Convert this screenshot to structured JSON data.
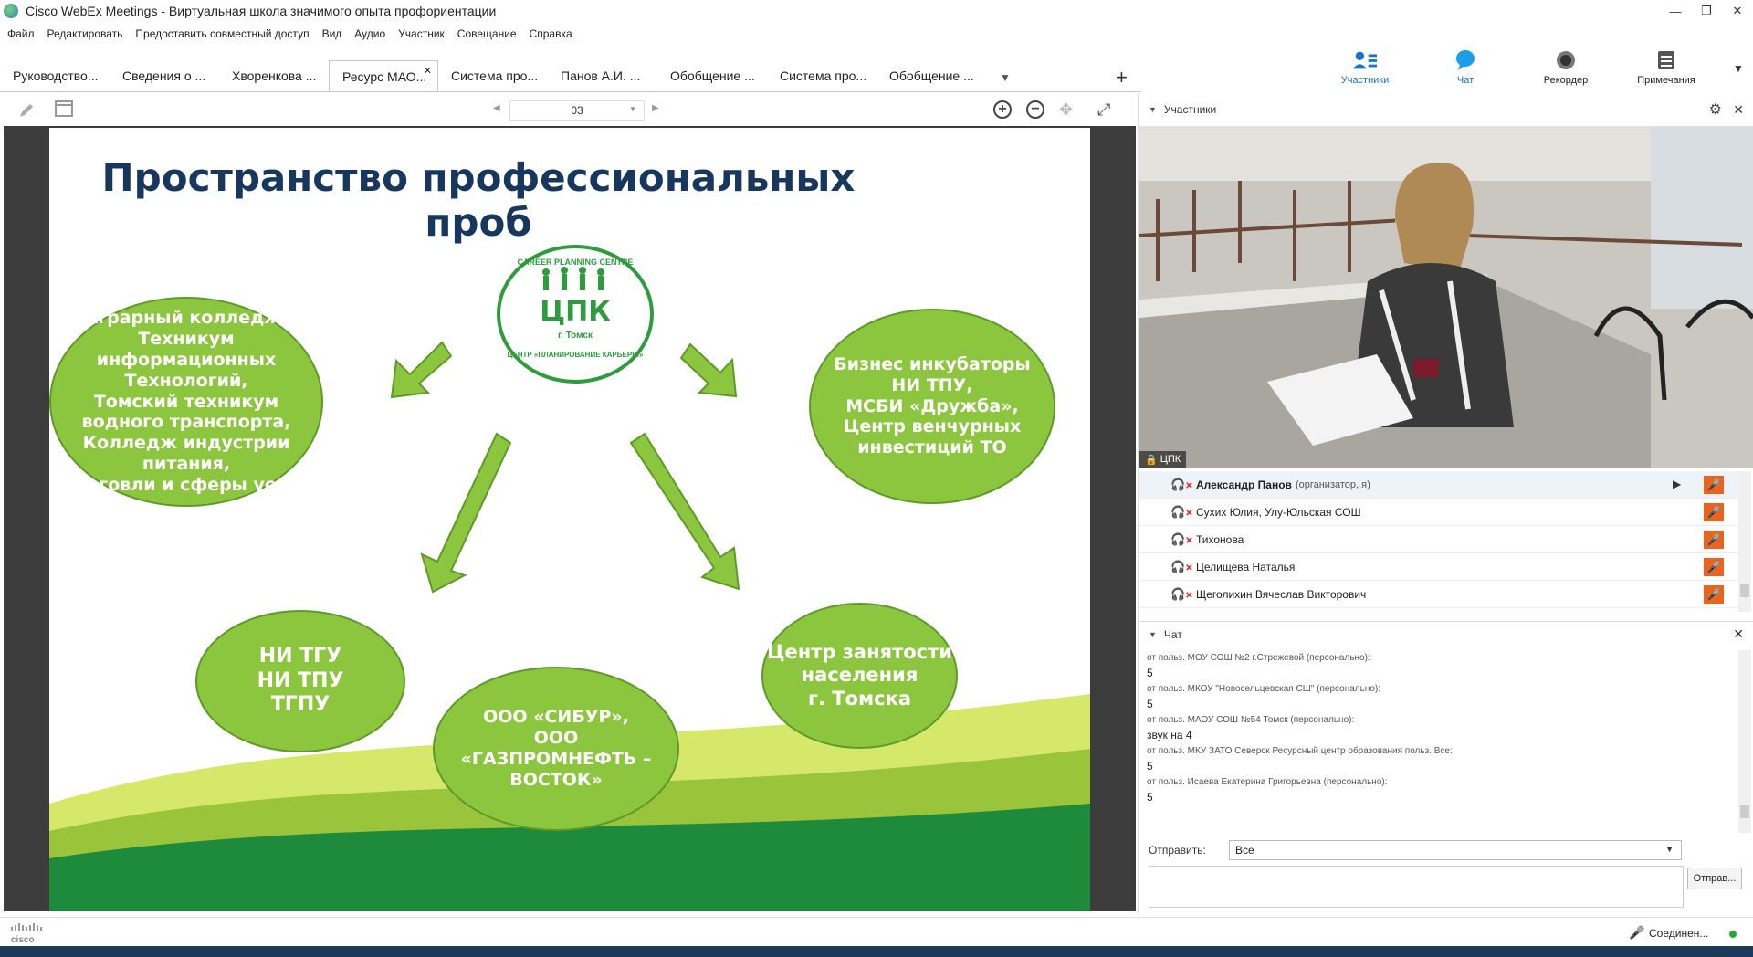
{
  "window": {
    "title": "Cisco WebEx Meetings - Виртуальная школа значимого опыта профориентации",
    "controls": [
      "minimize-icon",
      "restore-icon",
      "close-icon"
    ]
  },
  "menu": [
    "Файл",
    "Редактировать",
    "Предоставить совместный доступ",
    "Вид",
    "Аудио",
    "Участник",
    "Совещание",
    "Справка"
  ],
  "tabs": [
    {
      "label": "Руководство..."
    },
    {
      "label": "Сведения о ..."
    },
    {
      "label": "Хворенкова ..."
    },
    {
      "label": "Ресурс МАО...",
      "active": true
    },
    {
      "label": "Система про..."
    },
    {
      "label": "Панов А.И. ..."
    },
    {
      "label": "Обобщение ..."
    },
    {
      "label": "Система про..."
    },
    {
      "label": "Обобщение ..."
    }
  ],
  "right_toolbar": [
    {
      "label": "Участники",
      "icon": "participants-icon",
      "active": true
    },
    {
      "label": "Чат",
      "icon": "chat-icon",
      "active": true
    },
    {
      "label": "Рекордер",
      "icon": "recorder-icon"
    },
    {
      "label": "Примечания",
      "icon": "notes-icon"
    }
  ],
  "pres_toolbar": {
    "page": "03"
  },
  "slide": {
    "title": "Пространство профессиональных проб",
    "logo": {
      "main": "ЦПК",
      "city": "г. Томск",
      "ring_top": "CAREER PLANNING CENTRE",
      "ring_bottom": "ЦЕНТР «ПЛАНИРОВАНИЕ КАРЬЕРЫ»"
    },
    "ovals": {
      "left": "Аграрный колледж,\nТехникум\nинформационных\nТехнологий,\nТомский техникум\nводного транспорта,\nКолледж индустрии питания,\nторговли и сферы услуг",
      "right": "Бизнес инкубаторы\nНИ ТПУ,\nМСБИ «Дружба»,\nЦентр венчурных\nинвестиций ТО",
      "bottom_left": "НИ ТГУ\nНИ ТПУ\nТГПУ",
      "bottom_center": "ООО «СИБУР»,\nООО\n«ГАЗПРОМНЕФТЬ –\nВОСТОК»",
      "bottom_right": "Центр занятости\nнаселения\nг. Томска"
    }
  },
  "participants_panel": {
    "title": "Участники",
    "video_label": "ЦПК",
    "rows": [
      {
        "name": "Александр Панов",
        "role": "(организатор, я)",
        "bold": true
      },
      {
        "name": "Сухих Юлия, Улу-Юльская СОШ"
      },
      {
        "name": "Тихонова"
      },
      {
        "name": "Целищева Наталья"
      },
      {
        "name": "Щеголихин Вячеслав Викторович"
      }
    ]
  },
  "chat_panel": {
    "title": "Чат",
    "messages": [
      {
        "from": "от польз. МОУ СОШ №2 г.Стрежевой (персонально):",
        "text": "5"
      },
      {
        "from": "от польз. МКОУ \"Новосельцевская СШ\" (персонально):",
        "text": "5"
      },
      {
        "from": "от польз. МАОУ  СОШ №54 Томск (персонально):",
        "text": "звук на 4"
      },
      {
        "from": "от польз. МКУ ЗАТО Северск Ресурсный центр образования польз. Все:",
        "text": "5"
      },
      {
        "from": "от польз. Исаева Екатерина Григорьевна (персонально):",
        "text": "5"
      }
    ],
    "send_label": "Отправить:",
    "send_to": "Все",
    "send_button": "Отправ..."
  },
  "status": {
    "logo": "cisco",
    "text": "Соединен..."
  },
  "colors": {
    "slide_green": "#8cc63f",
    "slide_title": "#17375e",
    "accent_blue": "#1a73c9",
    "mic_orange": "#e8641f"
  }
}
